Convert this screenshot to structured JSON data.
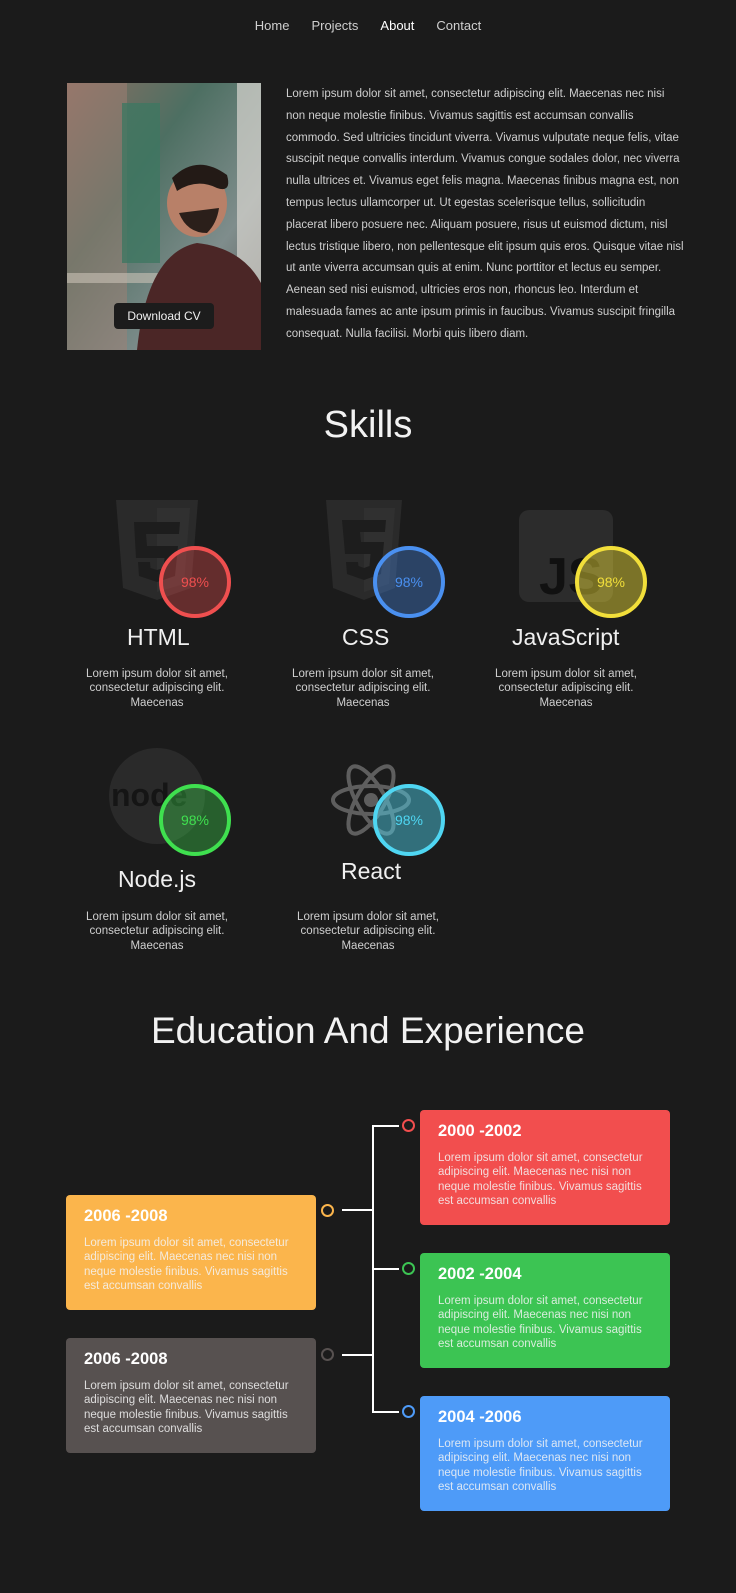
{
  "nav": {
    "home": "Home",
    "projects": "Projects",
    "about": "About",
    "contact": "Contact"
  },
  "hero": {
    "download_label": "Download CV",
    "intro": "Lorem ipsum dolor sit amet, consectetur adipiscing elit. Maecenas nec nisi non neque molestie finibus. Vivamus sagittis est accumsan convallis commodo. Sed ultricies tincidunt viverra. Vivamus vulputate neque felis, vitae suscipit neque convallis interdum. Vivamus congue sodales dolor, nec viverra nulla ultrices et. Vivamus eget felis magna. Maecenas finibus magna est, non tempus lectus ullamcorper ut. Ut egestas scelerisque tellus, sollicitudin placerat libero posuere nec. Aliquam posuere, risus ut euismod dictum, nisl lectus tristique libero, non pellentesque elit ipsum quis eros. Quisque vitae nisl ut ante viverra accumsan quis at enim. Nunc porttitor et lectus eu semper. Aenean sed nisi euismod, ultricies eros non, rhoncus leo. Interdum et malesuada fames ac ante ipsum primis in faucibus. Vivamus suscipit fringilla consequat. Nulla facilisi. Morbi quis libero diam."
  },
  "skills": {
    "title": "Skills",
    "items": [
      {
        "name": "HTML",
        "percent": "98%",
        "color": "#ef4f4f",
        "icon": "html5-icon",
        "desc": "Lorem ipsum dolor sit amet, consectetur adipiscing elit. Maecenas"
      },
      {
        "name": "CSS",
        "percent": "98%",
        "color": "#4a90f0",
        "icon": "css3-icon",
        "desc": "Lorem ipsum dolor sit amet, consectetur adipiscing elit. Maecenas"
      },
      {
        "name": "JavaScript",
        "percent": "98%",
        "color": "#f2df3a",
        "icon": "js-icon",
        "desc": "Lorem ipsum dolor sit amet, consectetur adipiscing elit. Maecenas"
      },
      {
        "name": "Node.js",
        "percent": "98%",
        "color": "#3fe04f",
        "icon": "nodejs-icon",
        "desc": "Lorem ipsum dolor sit amet, consectetur adipiscing elit. Maecenas"
      },
      {
        "name": "React",
        "percent": "98%",
        "color": "#4fd6f2",
        "icon": "react-icon",
        "desc": "Lorem ipsum dolor sit amet, consectetur adipiscing elit. Maecenas"
      }
    ]
  },
  "education": {
    "title": "Education And Experience",
    "items": [
      {
        "years": "2000 -2002",
        "color": "#f24e4e",
        "text": "Lorem ipsum dolor sit amet, consectetur adipiscing elit. Maecenas nec nisi non neque molestie finibus. Vivamus sagittis est accumsan convallis"
      },
      {
        "years": "2006 -2008",
        "color": "#fbb54c",
        "text": "Lorem ipsum dolor sit amet, consectetur adipiscing elit. Maecenas nec nisi non neque molestie finibus. Vivamus sagittis est accumsan convallis"
      },
      {
        "years": "2002 -2004",
        "color": "#3cc453",
        "text": "Lorem ipsum dolor sit amet, consectetur adipiscing elit. Maecenas nec nisi non neque molestie finibus. Vivamus sagittis est accumsan convallis"
      },
      {
        "years": "2006 -2008",
        "color": "#575150",
        "text": "Lorem ipsum dolor sit amet, consectetur adipiscing elit. Maecenas nec nisi non neque molestie finibus. Vivamus sagittis est accumsan convallis"
      },
      {
        "years": "2004 -2006",
        "color": "#4e9bf8",
        "text": "Lorem ipsum dolor sit amet, consectetur adipiscing elit. Maecenas nec nisi non neque molestie finibus. Vivamus sagittis est accumsan convallis"
      }
    ]
  }
}
